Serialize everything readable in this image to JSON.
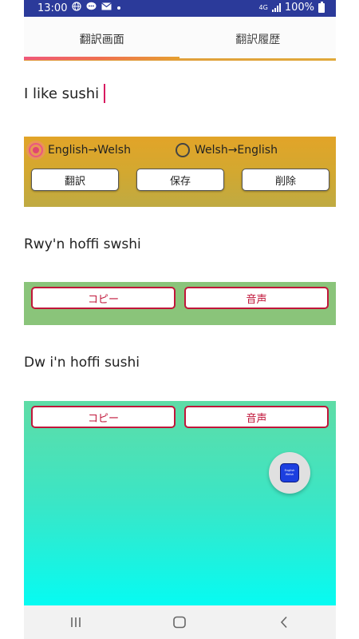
{
  "status_bar": {
    "time": "13:00",
    "left_icons": [
      "globe-icon",
      "chat-icon",
      "mail-icon",
      "dot-icon"
    ],
    "network": "4G",
    "battery": "100%"
  },
  "tabs": [
    {
      "label": "翻訳画面",
      "active": true
    },
    {
      "label": "翻訳履歴",
      "active": false
    }
  ],
  "input": {
    "value": "I like sushi"
  },
  "direction": {
    "options": [
      {
        "label": "English→Welsh",
        "selected": true
      },
      {
        "label": "Welsh→English",
        "selected": false
      }
    ]
  },
  "actions": {
    "translate_label": "翻訳",
    "save_label": "保存",
    "delete_label": "削除"
  },
  "results": [
    {
      "text": "Rwy'n hoffi swshi",
      "copy_label": "コピー",
      "speak_label": "音声"
    },
    {
      "text": "Dw i'n hoffi sushi",
      "copy_label": "コピー",
      "speak_label": "音声"
    }
  ],
  "fab": {
    "logo_line1": "English",
    "logo_line2": "Welsh"
  },
  "colors": {
    "status_bar": "#2b3a9a",
    "accent_pink": "#e04670",
    "button_border_red": "#c0163a",
    "options_panel": "#d6a82e",
    "result_panel_1": "#8ac47a",
    "result_panel_2_top": "#5fdca6",
    "result_panel_2_bottom": "#06fbf2"
  }
}
